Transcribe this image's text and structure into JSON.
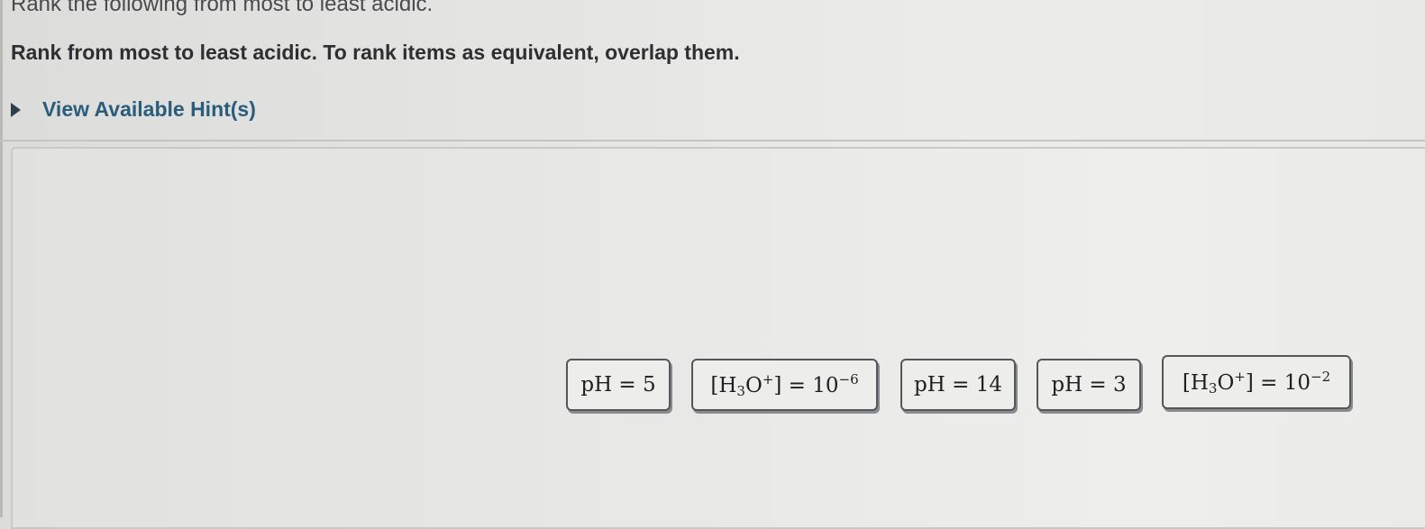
{
  "question": {
    "title": "Rank the following from most to least acidic.",
    "instructions": "Rank from most to least acidic. To rank items as equivalent, overlap them.",
    "hint_label": "View Available Hint(s)"
  },
  "items": [
    {
      "prefix": "pH = 5"
    },
    {
      "prefix": "[H",
      "sub": "3",
      "mid": "O",
      "sup": "+",
      "tail": "] = 10",
      "exp": "−6"
    },
    {
      "prefix": "pH = 14"
    },
    {
      "prefix": "pH = 3"
    },
    {
      "prefix": "[H",
      "sub": "3",
      "mid": "O",
      "sup": "+",
      "tail": "] = 10",
      "exp": "−2"
    }
  ],
  "icons": {
    "hint_toggle": "caret-right-icon"
  },
  "colors": {
    "hint_link": "#2a5d7c",
    "item_border": "#55565a"
  }
}
